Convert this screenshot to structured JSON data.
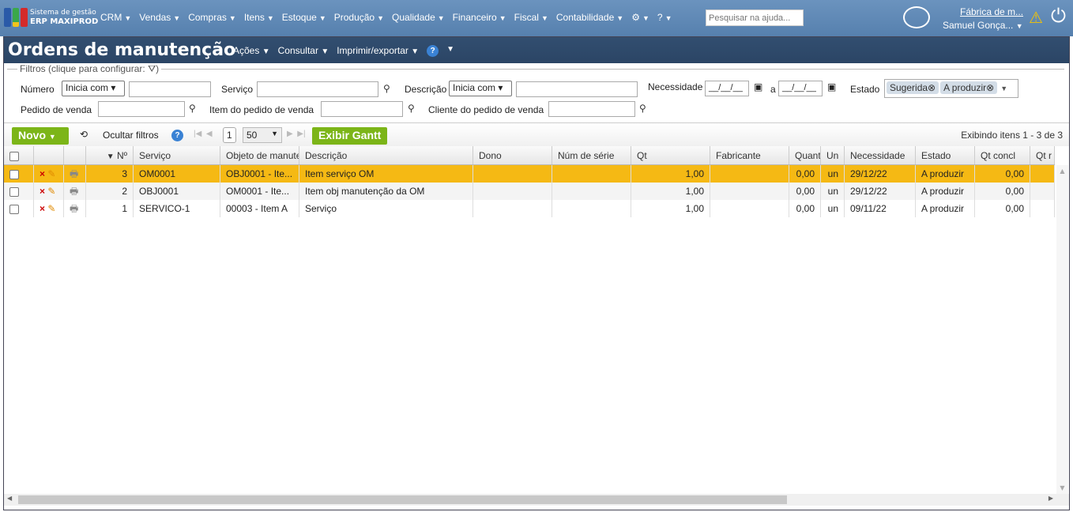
{
  "app": {
    "brand_line1": "Sistema de gestão",
    "brand_line2": "ERP MAXIPROD",
    "menu": [
      "CRM",
      "Vendas",
      "Compras",
      "Itens",
      "Estoque",
      "Produção",
      "Qualidade",
      "Financeiro",
      "Fiscal",
      "Contabilidade"
    ],
    "help_search_placeholder": "Pesquisar na ajuda...",
    "company": "Fábrica de m...",
    "user": "Samuel Gonça..."
  },
  "page": {
    "title": "Ordens de manutenção",
    "menu": [
      "Ações",
      "Consultar",
      "Imprimir/exportar"
    ]
  },
  "filters": {
    "legend": "Filtros (clique para configurar:",
    "numero": "Número",
    "numero_op": "Inicia com",
    "servico": "Serviço",
    "descricao": "Descrição",
    "descricao_op": "Inicia com",
    "necessidade": "Necessidade",
    "date_placeholder": "__/__/__",
    "a": "a",
    "estado": "Estado",
    "estado_chips": [
      "Sugerida",
      "A produzir"
    ],
    "pedido": "Pedido de venda",
    "item_pedido": "Item do pedido de venda",
    "cliente_pedido": "Cliente do pedido de venda"
  },
  "toolbar": {
    "novo": "Novo",
    "ocultar": "Ocultar filtros",
    "page": "1",
    "page_size": "50",
    "gantt": "Exibir Gantt",
    "status": "Exibindo itens 1 - 3 de 3"
  },
  "grid": {
    "columns": [
      "Nº",
      "Serviço",
      "Objeto de manutenção",
      "Descrição",
      "Dono",
      "Núm de série",
      "Qt",
      "Fabricante",
      "Quant",
      "Un",
      "Necessidade",
      "Estado",
      "Qt concl",
      "Qt r"
    ],
    "rows": [
      [
        "3",
        "OM0001",
        "OBJ0001 - Ite...",
        "Item serviço OM",
        "",
        "",
        "1,00",
        "",
        "0,00",
        "un",
        "29/12/22",
        "A produzir",
        "0,00",
        ""
      ],
      [
        "2",
        "OBJ0001",
        "OM0001 - Ite...",
        "Item obj manutenção da OM",
        "",
        "",
        "1,00",
        "",
        "0,00",
        "un",
        "29/12/22",
        "A produzir",
        "0,00",
        ""
      ],
      [
        "1",
        "SERVICO-1",
        "00003 - Item A",
        "Serviço",
        "",
        "",
        "1,00",
        "",
        "0,00",
        "un",
        "09/11/22",
        "A produzir",
        "0,00",
        ""
      ]
    ],
    "selected_row_color": "#f5b914"
  }
}
